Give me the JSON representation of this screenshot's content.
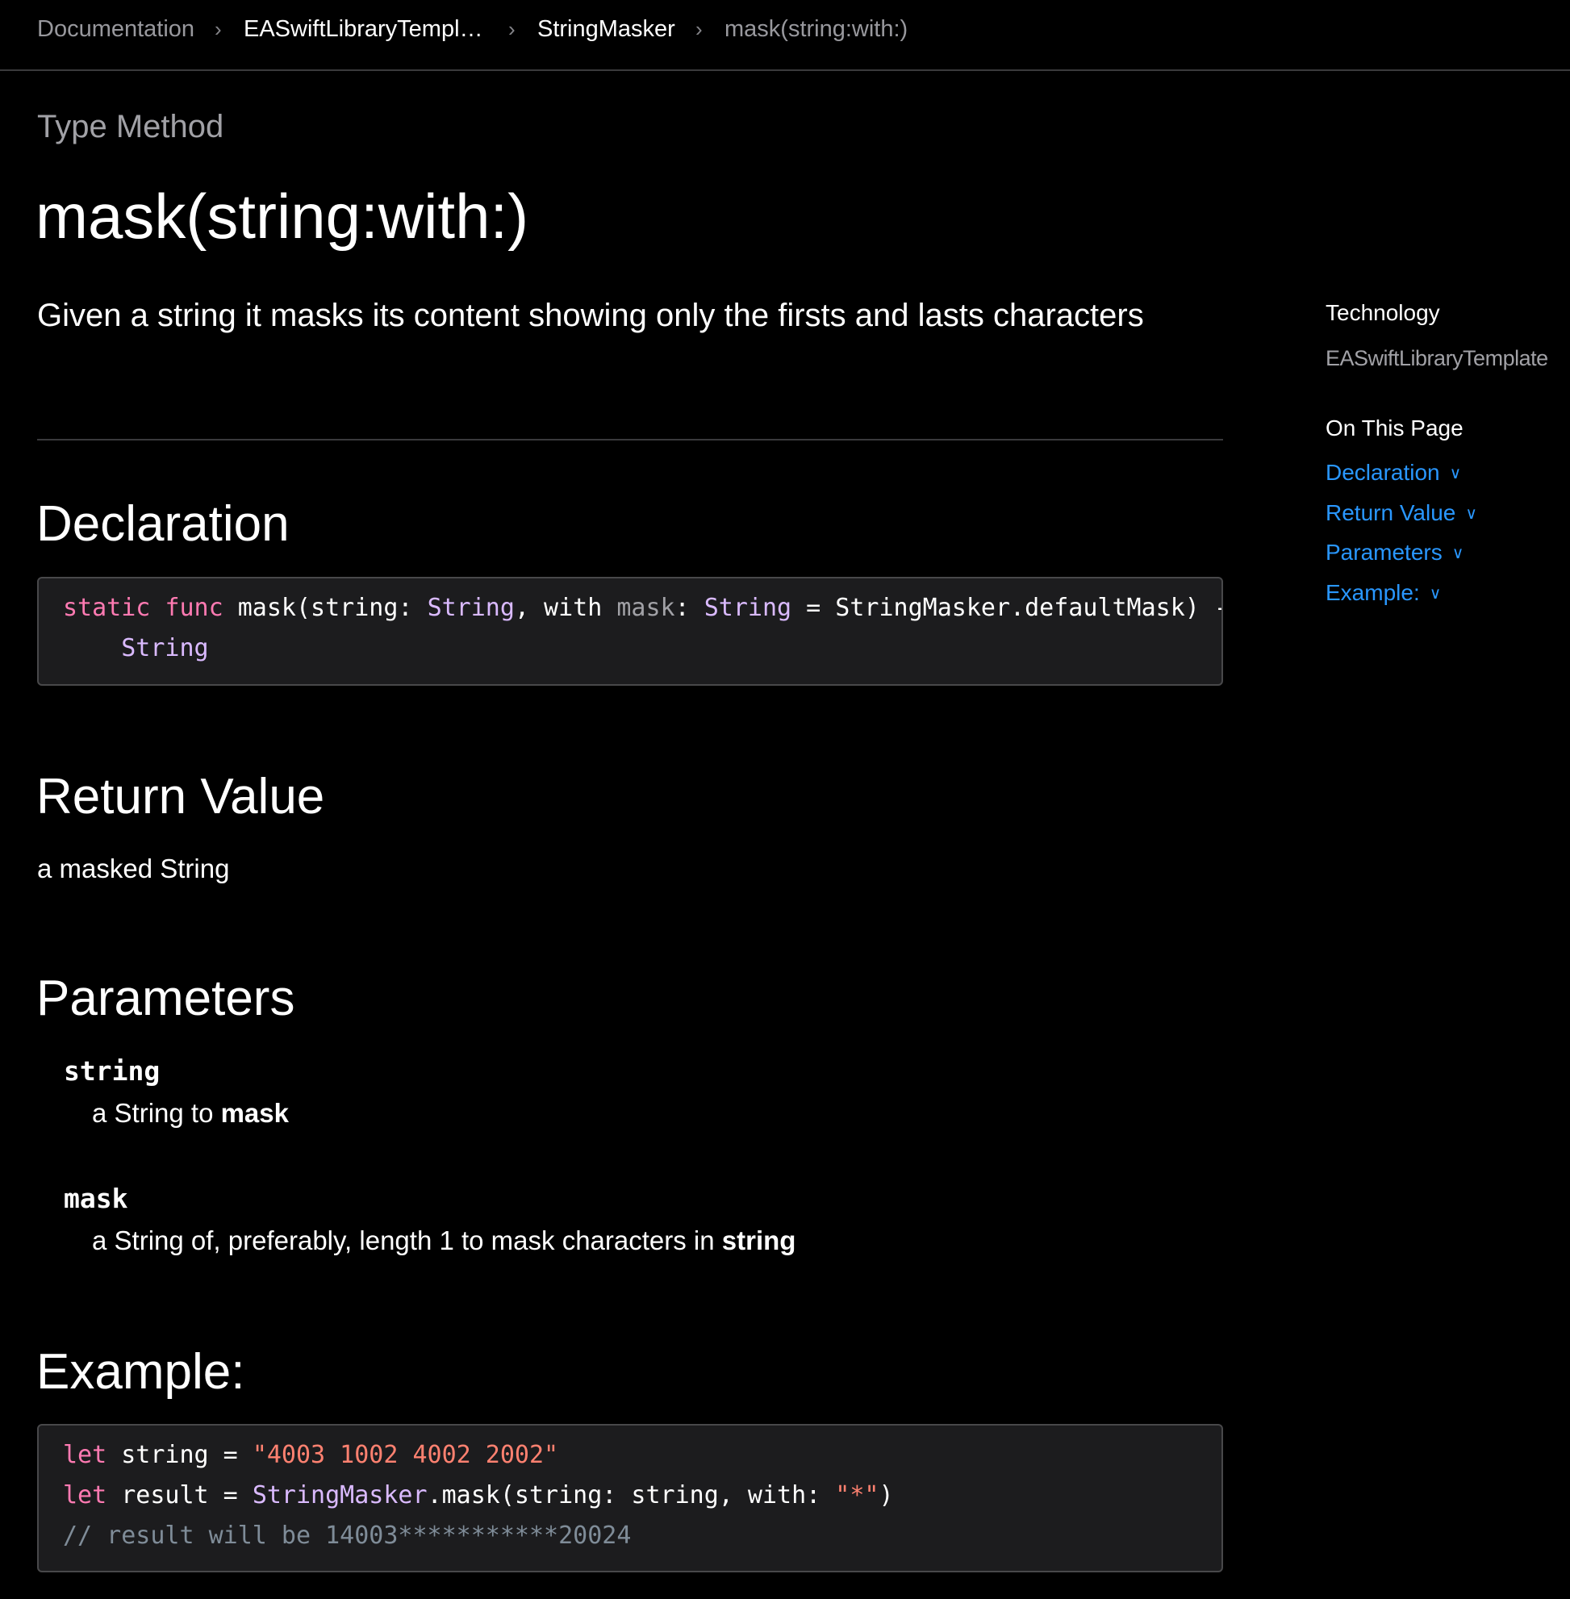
{
  "breadcrumb": {
    "items": [
      {
        "label": "Documentation"
      },
      {
        "label": "EASwiftLibraryTempl…"
      },
      {
        "label": "StringMasker"
      },
      {
        "label": "mask(string:with:)"
      }
    ],
    "separator": "›"
  },
  "header": {
    "eyebrow": "Type Method",
    "title": "mask(string:with:)",
    "abstract": "Given a string it masks its content showing only the firsts and lasts characters"
  },
  "declaration": {
    "heading": "Declaration",
    "tokens": {
      "static": "static",
      "func": "func",
      "name": " mask(string: ",
      "type1": "String",
      "with": ", with ",
      "param": "mask",
      "colon": ": ",
      "type2": "String",
      "default": " = StringMasker.defaultMask) ->",
      "indent": "\n    ",
      "return_type": "String"
    }
  },
  "return_value": {
    "heading": "Return Value",
    "text": "a masked String"
  },
  "parameters": {
    "heading": "Parameters",
    "items": [
      {
        "name": "string",
        "desc_prefix": "a String to ",
        "desc_bold": "mask"
      },
      {
        "name": "mask",
        "desc_prefix": "a String of, preferably, length 1 to mask characters in ",
        "desc_bold": "string"
      }
    ]
  },
  "example": {
    "heading": "Example:",
    "line1": {
      "kw": "let",
      "plain": " string = ",
      "str": "\"4003 1002 4002 2002\""
    },
    "line2": {
      "kw": "let",
      "plain": " result = ",
      "type": "StringMasker",
      "call": ".mask(string: string, with: ",
      "str": "\"*\"",
      "end": ")"
    },
    "line3": {
      "comment": "// result will be 14003***********20024"
    }
  },
  "aside": {
    "technology_label": "Technology",
    "technology_value": "EASwiftLibraryTemplate",
    "on_this_page_label": "On This Page",
    "toc": [
      {
        "label": "Declaration"
      },
      {
        "label": "Return Value"
      },
      {
        "label": "Parameters"
      },
      {
        "label": "Example:"
      }
    ],
    "toc_chevron": "∨"
  },
  "colors": {
    "background": "#000000",
    "link": "#2997ff",
    "keyword": "#ff7ab2",
    "type": "#dabaff",
    "string": "#ff8170",
    "comment": "#7f8c98"
  }
}
